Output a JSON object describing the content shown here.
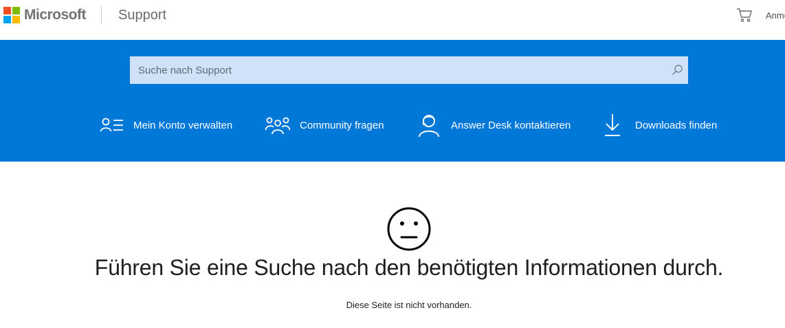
{
  "header": {
    "brand": "Microsoft",
    "section_title": "Support",
    "cart_icon": "shopping-cart-icon",
    "signin_label": "Anme"
  },
  "colors": {
    "brand_blue": "#0078d7",
    "search_bg": "#cfe2f8",
    "logo_red": "#f25022",
    "logo_green": "#7fba00",
    "logo_blue": "#00a4ef",
    "logo_yellow": "#ffb900"
  },
  "search": {
    "placeholder": "Suche nach Support",
    "value": "",
    "icon": "search-icon"
  },
  "quick_links": [
    {
      "label": "Mein Konto verwalten",
      "icon": "account-list-icon"
    },
    {
      "label": "Community fragen",
      "icon": "community-icon"
    },
    {
      "label": "Answer Desk kontaktieren",
      "icon": "headset-icon"
    },
    {
      "label": "Downloads finden",
      "icon": "download-icon"
    }
  ],
  "main": {
    "face_icon": "neutral-face-icon",
    "headline": "Führen Sie eine Suche nach den benötigten Informationen durch.",
    "message": "Diese Seite ist nicht vorhanden."
  }
}
